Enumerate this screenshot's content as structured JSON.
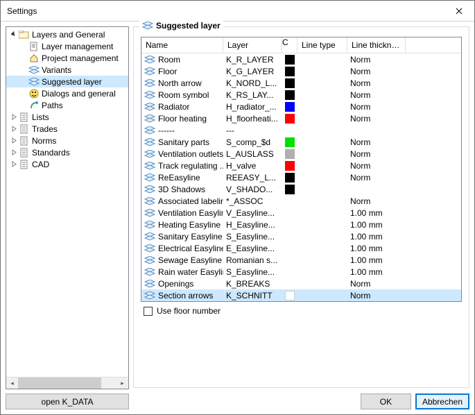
{
  "window": {
    "title": "Settings"
  },
  "tree": {
    "root": {
      "label": "Layers and General"
    },
    "children": [
      {
        "label": "Layer management",
        "icon": "doc"
      },
      {
        "label": "Project management",
        "icon": "house"
      },
      {
        "label": "Variants",
        "icon": "layer"
      },
      {
        "label": "Suggested layer",
        "icon": "layer",
        "selected": true
      },
      {
        "label": "Dialogs and general",
        "icon": "smiley"
      },
      {
        "label": "Paths",
        "icon": "path"
      }
    ],
    "siblings": [
      {
        "label": "Lists"
      },
      {
        "label": "Trades"
      },
      {
        "label": "Norms"
      },
      {
        "label": "Standards"
      },
      {
        "label": "CAD"
      }
    ],
    "open_kdata": "open K_DATA"
  },
  "group": {
    "title": "Suggested layer"
  },
  "table": {
    "headers": {
      "name": "Name",
      "layer": "Layer",
      "c": "C",
      "lt": "Line type",
      "lw": "Line thickness"
    },
    "rows": [
      {
        "name": "Room",
        "layer": "K_R_LAYER",
        "color": "#000000",
        "lt": "",
        "lw": "Norm",
        "icon": true
      },
      {
        "name": "Floor",
        "layer": "K_G_LAYER",
        "color": "#000000",
        "lt": "",
        "lw": "Norm",
        "icon": true
      },
      {
        "name": "North arrow",
        "layer": "K_NORD_L...",
        "color": "#000000",
        "lt": "",
        "lw": "Norm",
        "icon": true
      },
      {
        "name": "Room symbol",
        "layer": "K_RS_LAY...",
        "color": "#000000",
        "lt": "",
        "lw": "Norm",
        "icon": true
      },
      {
        "name": "Radiator",
        "layer": "H_radiator_...",
        "color": "#0000ff",
        "lt": "",
        "lw": "Norm",
        "icon": true
      },
      {
        "name": "Floor heating",
        "layer": "H_floorheati...",
        "color": "#ff0000",
        "lt": "",
        "lw": "Norm",
        "icon": true
      },
      {
        "name": "------",
        "layer": "---",
        "color": "",
        "lt": "",
        "lw": "",
        "icon": true
      },
      {
        "name": "Sanitary parts",
        "layer": "S_comp_$d",
        "color": "#00e000",
        "lt": "",
        "lw": "Norm",
        "icon": true
      },
      {
        "name": "Ventilation outlets",
        "layer": "L_AUSLASS",
        "color": "#b0b0b0",
        "lt": "",
        "lw": "Norm",
        "icon": true
      },
      {
        "name": "Track regulating ...",
        "layer": "H_valve",
        "color": "#ff0000",
        "lt": "",
        "lw": "Norm",
        "icon": true
      },
      {
        "name": "ReEasyline",
        "layer": "REEASY_L...",
        "color": "#000000",
        "lt": "",
        "lw": "Norm",
        "icon": true
      },
      {
        "name": "3D Shadows",
        "layer": "V_SHADO...",
        "color": "#000000",
        "lt": "",
        "lw": "",
        "icon": true
      },
      {
        "name": "Associated labeling",
        "layer": "*_ASSOC",
        "color": "",
        "lt": "",
        "lw": "Norm",
        "icon": true
      },
      {
        "name": "Ventilation Easyline",
        "layer": "V_Easyline...",
        "color": "",
        "lt": "",
        "lw": "1.00 mm",
        "icon": true
      },
      {
        "name": "Heating Easyline",
        "layer": "H_Easyline...",
        "color": "",
        "lt": "",
        "lw": "1.00 mm",
        "icon": true
      },
      {
        "name": "Sanitary Easyline",
        "layer": "S_Easyline...",
        "color": "",
        "lt": "",
        "lw": "1.00 mm",
        "icon": true
      },
      {
        "name": "Electrical Easyline",
        "layer": "E_Easyline...",
        "color": "",
        "lt": "",
        "lw": "1.00 mm",
        "icon": true
      },
      {
        "name": "Sewage Easyline",
        "layer": "Romanian s...",
        "color": "",
        "lt": "",
        "lw": "1.00 mm",
        "icon": true
      },
      {
        "name": "Rain water Easyline",
        "layer": "S_Easyline...",
        "color": "",
        "lt": "",
        "lw": "1.00 mm",
        "icon": true
      },
      {
        "name": "Openings",
        "layer": "K_BREAKS",
        "color": "",
        "lt": "",
        "lw": "Norm",
        "icon": true
      },
      {
        "name": "Section arrows",
        "layer": "K_SCHNITT",
        "color": "#ffffff",
        "lt": "",
        "lw": "Norm",
        "icon": true,
        "selected": true
      }
    ]
  },
  "options": {
    "use_floor_number": "Use floor number"
  },
  "buttons": {
    "ok": "OK",
    "cancel": "Abbrechen"
  }
}
